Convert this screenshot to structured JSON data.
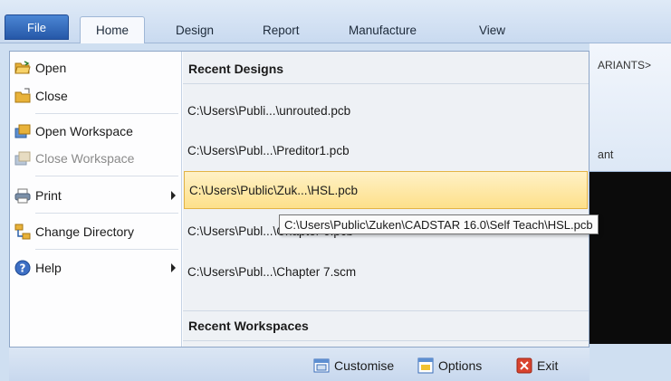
{
  "tabs": {
    "file": "File",
    "items": [
      "Home",
      "Design",
      "Report",
      "Manufacture",
      "View"
    ]
  },
  "ribbon": {
    "partial_label": "ARIANTS>",
    "partial_caption": "ant"
  },
  "file_menu": {
    "items": [
      {
        "label": "Open",
        "icon": "open-folder-icon"
      },
      {
        "label": "Close",
        "icon": "close-folder-icon"
      },
      {
        "label": "Open Workspace",
        "icon": "open-workspace-icon"
      },
      {
        "label": "Close Workspace",
        "icon": "close-workspace-icon",
        "disabled": true
      },
      {
        "label": "Print",
        "icon": "printer-icon",
        "submenu": true
      },
      {
        "label": "Change Directory",
        "icon": "change-directory-icon"
      },
      {
        "label": "Help",
        "icon": "help-icon",
        "submenu": true
      }
    ],
    "recent_designs_title": "Recent Designs",
    "recent_designs": [
      "C:\\Users\\Publi...\\unrouted.pcb",
      "C:\\Users\\Publ...\\Preditor1.pcb",
      "C:\\Users\\Public\\Zuk...\\HSL.pcb",
      "C:\\Users\\Publ...\\Chapter 6.pcb",
      "C:\\Users\\Publ...\\Chapter 7.scm"
    ],
    "recent_workspaces_title": "Recent Workspaces",
    "tooltip": "C:\\Users\\Public\\Zuken\\CADSTAR 16.0\\Self Teach\\HSL.pcb"
  },
  "footer": {
    "customise": "Customise",
    "options": "Options",
    "exit": "Exit"
  }
}
